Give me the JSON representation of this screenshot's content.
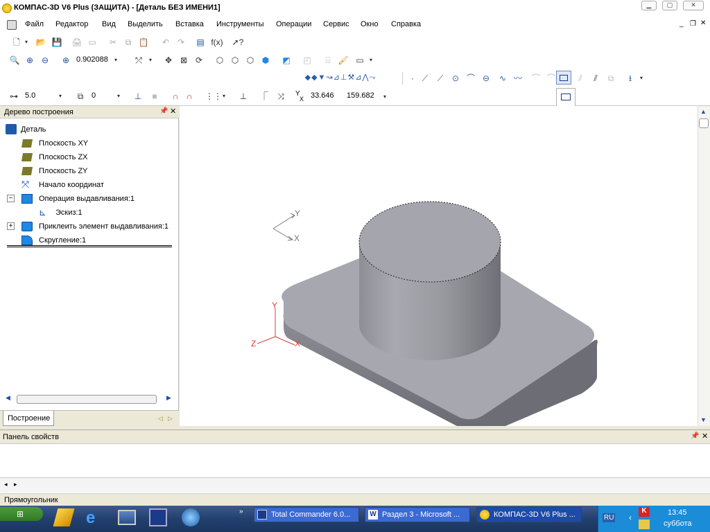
{
  "title": "КОМПАС-3D V6 Plus (ЗАЩИТА) - [Деталь БЕЗ ИМЕНИ1]",
  "menu": [
    {
      "label": "Файл",
      "key": "Ф"
    },
    {
      "label": "Редактор",
      "key": "Р"
    },
    {
      "label": "Вид",
      "key": "В"
    },
    {
      "label": "Выделить",
      "key": "ы"
    },
    {
      "label": "Вставка",
      "key": "с"
    },
    {
      "label": "Инструменты",
      "key": "И"
    },
    {
      "label": "Операции",
      "key": "О"
    },
    {
      "label": "Сервис",
      "key": "С"
    },
    {
      "label": "Окно",
      "key": "О"
    },
    {
      "label": "Справка",
      "key": "п"
    }
  ],
  "toolbar": {
    "zoom_value": "0.902088",
    "step_value": "5.0",
    "layer_value": "0",
    "coord_y": "33.646",
    "coord_x": "159.682",
    "coord_label": "Y",
    "coord_label2": "X"
  },
  "icons": {
    "view_tools": "zoom-icons",
    "function_label": "f(x)"
  },
  "tree": {
    "title": "Дерево построения",
    "items": [
      {
        "label": "Деталь",
        "indent": 0,
        "icon": "part-icon"
      },
      {
        "label": "Плоскость XY",
        "indent": 1,
        "icon": "plane-icon"
      },
      {
        "label": "Плоскость ZX",
        "indent": 1,
        "icon": "plane-icon"
      },
      {
        "label": "Плоскость ZY",
        "indent": 1,
        "icon": "plane-icon"
      },
      {
        "label": "Начало координат",
        "indent": 1,
        "icon": "origin-icon"
      },
      {
        "label": "Операция выдавливания:1",
        "indent": 1,
        "icon": "extrude-icon",
        "expander": "−"
      },
      {
        "label": "Эскиз:1",
        "indent": 2,
        "icon": "sketch-icon"
      },
      {
        "label": "Приклеить элемент выдавливания:1",
        "indent": 1,
        "icon": "boss-icon",
        "expander": "+"
      },
      {
        "label": "Скругление:1",
        "indent": 1,
        "icon": "fillet-icon"
      }
    ],
    "tab": "Построение"
  },
  "axes": {
    "y": "Y",
    "x": "X",
    "z": "Z"
  },
  "properties": {
    "title": "Панель свойств"
  },
  "status": {
    "text": "Прямоугольник"
  },
  "taskbar": {
    "tasks": [
      "Total Commander 6.0...",
      "Раздел 3 - Microsoft ...",
      "КОМПАС-3D V6 Plus ..."
    ],
    "lang": "RU",
    "time": "13:45",
    "day": "суббота"
  }
}
